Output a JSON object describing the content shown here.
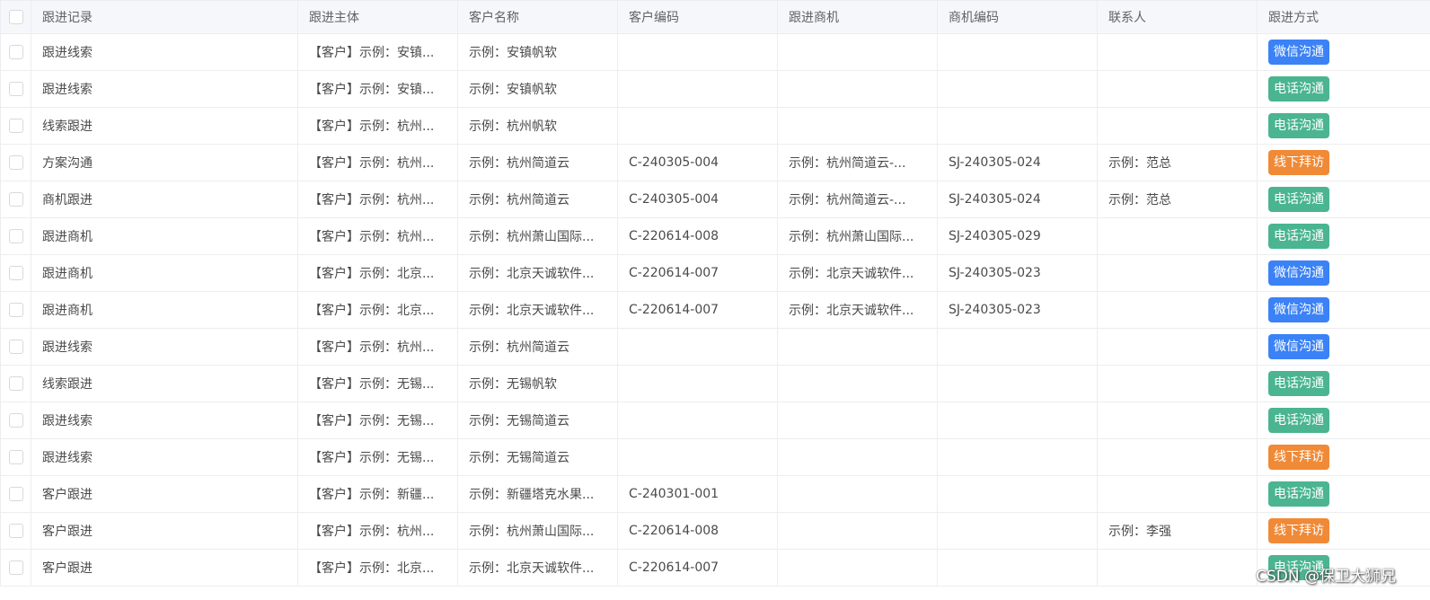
{
  "headers": [
    "跟进记录",
    "跟进主体",
    "客户名称",
    "客户编码",
    "跟进商机",
    "商机编码",
    "联系人",
    "跟进方式"
  ],
  "method_colors": {
    "微信沟通": "#3b82f6",
    "电话沟通": "#4ab590",
    "线下拜访": "#f08a37"
  },
  "rows": [
    {
      "record": "跟进线索",
      "subject": "【客户】示例：安镇...",
      "customer": "示例：安镇帆软",
      "code": "",
      "opportunity": "",
      "opp_code": "",
      "contact": "",
      "method": "微信沟通"
    },
    {
      "record": "跟进线索",
      "subject": "【客户】示例：安镇...",
      "customer": "示例：安镇帆软",
      "code": "",
      "opportunity": "",
      "opp_code": "",
      "contact": "",
      "method": "电话沟通"
    },
    {
      "record": "线索跟进",
      "subject": "【客户】示例：杭州...",
      "customer": "示例：杭州帆软",
      "code": "",
      "opportunity": "",
      "opp_code": "",
      "contact": "",
      "method": "电话沟通"
    },
    {
      "record": "方案沟通",
      "subject": "【客户】示例：杭州...",
      "customer": "示例：杭州简道云",
      "code": "C-240305-004",
      "opportunity": "示例：杭州简道云-...",
      "opp_code": "SJ-240305-024",
      "contact": "示例：范总",
      "method": "线下拜访"
    },
    {
      "record": "商机跟进",
      "subject": "【客户】示例：杭州...",
      "customer": "示例：杭州简道云",
      "code": "C-240305-004",
      "opportunity": "示例：杭州简道云-...",
      "opp_code": "SJ-240305-024",
      "contact": "示例：范总",
      "method": "电话沟通"
    },
    {
      "record": "跟进商机",
      "subject": "【客户】示例：杭州...",
      "customer": "示例：杭州萧山国际...",
      "code": "C-220614-008",
      "opportunity": "示例：杭州萧山国际...",
      "opp_code": "SJ-240305-029",
      "contact": "",
      "method": "电话沟通"
    },
    {
      "record": "跟进商机",
      "subject": "【客户】示例：北京...",
      "customer": "示例：北京天诚软件...",
      "code": "C-220614-007",
      "opportunity": "示例：北京天诚软件...",
      "opp_code": "SJ-240305-023",
      "contact": "",
      "method": "微信沟通"
    },
    {
      "record": "跟进商机",
      "subject": "【客户】示例：北京...",
      "customer": "示例：北京天诚软件...",
      "code": "C-220614-007",
      "opportunity": "示例：北京天诚软件...",
      "opp_code": "SJ-240305-023",
      "contact": "",
      "method": "微信沟通"
    },
    {
      "record": "跟进线索",
      "subject": "【客户】示例：杭州...",
      "customer": "示例：杭州简道云",
      "code": "",
      "opportunity": "",
      "opp_code": "",
      "contact": "",
      "method": "微信沟通"
    },
    {
      "record": "线索跟进",
      "subject": "【客户】示例：无锡...",
      "customer": "示例：无锡帆软",
      "code": "",
      "opportunity": "",
      "opp_code": "",
      "contact": "",
      "method": "电话沟通"
    },
    {
      "record": "跟进线索",
      "subject": "【客户】示例：无锡...",
      "customer": "示例：无锡简道云",
      "code": "",
      "opportunity": "",
      "opp_code": "",
      "contact": "",
      "method": "电话沟通"
    },
    {
      "record": "跟进线索",
      "subject": "【客户】示例：无锡...",
      "customer": "示例：无锡简道云",
      "code": "",
      "opportunity": "",
      "opp_code": "",
      "contact": "",
      "method": "线下拜访"
    },
    {
      "record": "客户跟进",
      "subject": "【客户】示例：新疆...",
      "customer": "示例：新疆塔克水果...",
      "code": "C-240301-001",
      "opportunity": "",
      "opp_code": "",
      "contact": "",
      "method": "电话沟通"
    },
    {
      "record": "客户跟进",
      "subject": "【客户】示例：杭州...",
      "customer": "示例：杭州萧山国际...",
      "code": "C-220614-008",
      "opportunity": "",
      "opp_code": "",
      "contact": "示例：李强",
      "method": "线下拜访"
    },
    {
      "record": "客户跟进",
      "subject": "【客户】示例：北京...",
      "customer": "示例：北京天诚软件...",
      "code": "C-220614-007",
      "opportunity": "",
      "opp_code": "",
      "contact": "",
      "method": "电话沟通"
    }
  ],
  "watermark": "CSDN @保卫大狮兄"
}
